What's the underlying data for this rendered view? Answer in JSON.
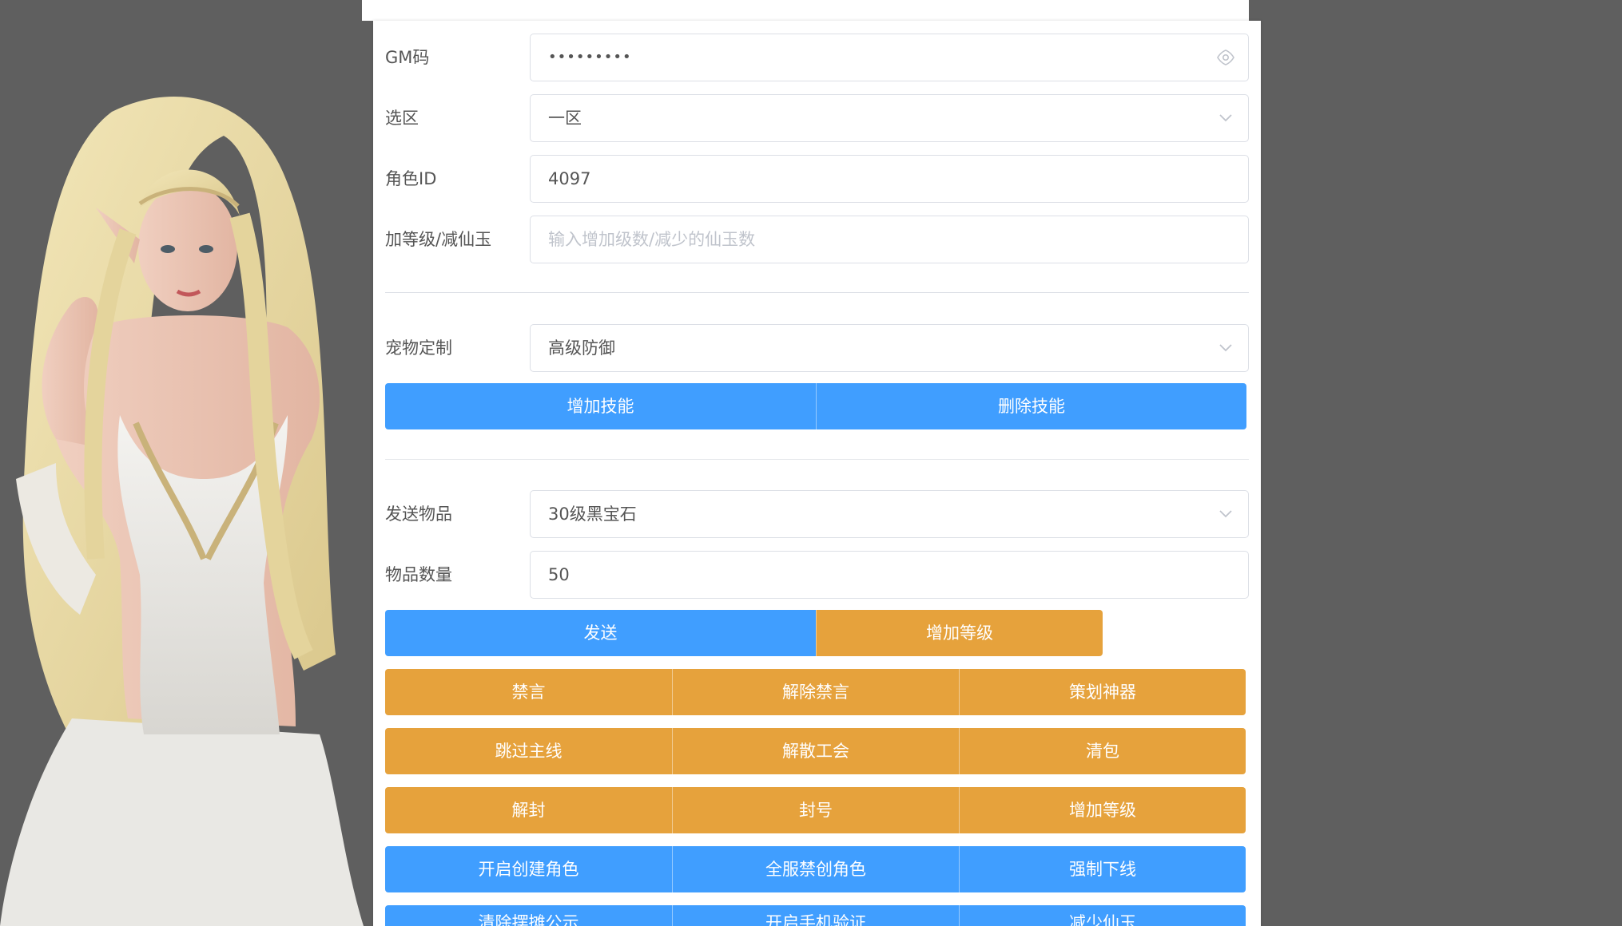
{
  "form": {
    "gm_code": {
      "label": "GM码",
      "value": "•••••••••"
    },
    "zone": {
      "label": "选区",
      "value": "一区"
    },
    "role_id": {
      "label": "角色ID",
      "value": "4097"
    },
    "level": {
      "label": "加等级/减仙玉",
      "placeholder": "输入增加级数/减少的仙玉数"
    },
    "pet": {
      "label": "宠物定制",
      "value": "高级防御"
    },
    "item": {
      "label": "发送物品",
      "value": "30级黑宝石"
    },
    "qty": {
      "label": "物品数量",
      "value": "50"
    }
  },
  "buttons": {
    "add_skill": "增加技能",
    "del_skill": "删除技能",
    "send": "发送",
    "add_level_1": "增加等级",
    "mute": "禁言",
    "unmute": "解除禁言",
    "planner_artifact": "策划神器",
    "skip_main": "跳过主线",
    "disband_guild": "解散工会",
    "clear_bag": "清包",
    "unban": "解封",
    "ban": "封号",
    "add_level_2": "增加等级",
    "open_create_role": "开启创建角色",
    "server_ban_create": "全服禁创角色",
    "force_offline": "强制下线",
    "partial_row": [
      "清除摆摊公示",
      "开启手机验证",
      "减少仙玉"
    ]
  },
  "colors": {
    "primary": "#409eff",
    "warning": "#e6a23c",
    "background": "#5f5f5f",
    "border": "#dcdfe6"
  },
  "icons": {
    "password_toggle": "eye-icon",
    "select_arrow": "chevron-down-icon"
  }
}
